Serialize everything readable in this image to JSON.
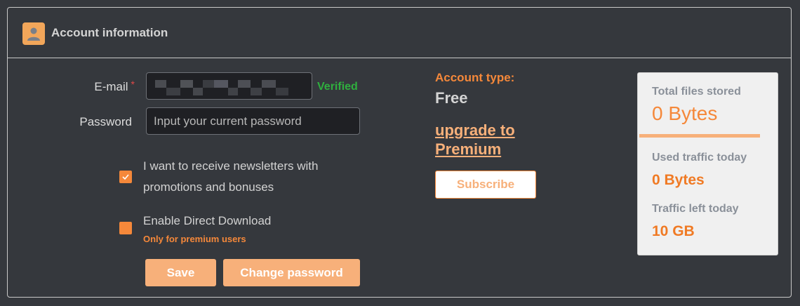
{
  "header": {
    "title": "Account information",
    "icon": "user-icon"
  },
  "form": {
    "email_label": "E-mail",
    "email_required": "*",
    "email_status": "Verified",
    "password_label": "Password",
    "password_placeholder": "Input your current password",
    "newsletter_line1": "I want to receive newsletters with",
    "newsletter_line2": "promotions and bonuses",
    "newsletter_checked": true,
    "direct_download_label": "Enable Direct Download",
    "direct_download_note": "Only for premium users",
    "direct_download_checked": false,
    "save_label": "Save",
    "change_password_label": "Change password"
  },
  "account": {
    "type_label": "Account type:",
    "type_value": "Free",
    "upgrade_line1": "upgrade to",
    "upgrade_line2": "Premium",
    "subscribe_label": "Subscribe"
  },
  "stats": {
    "files_label": "Total files stored",
    "files_value": "0 Bytes",
    "traffic_used_label": "Used traffic today",
    "traffic_used_value": "0 Bytes",
    "traffic_left_label": "Traffic left today",
    "traffic_left_value": "10 GB"
  },
  "colors": {
    "accent": "#f5883a",
    "accent_light": "#f7b07a",
    "verified": "#2fae3e",
    "background": "#35383d"
  }
}
